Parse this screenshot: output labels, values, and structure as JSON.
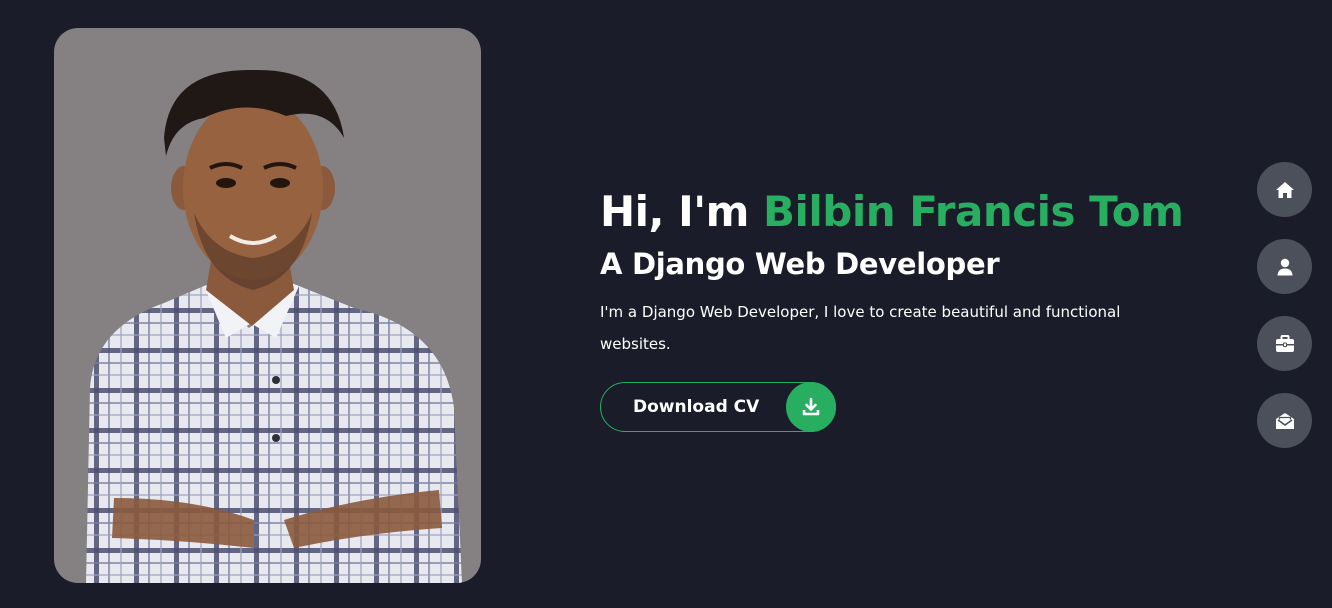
{
  "hero": {
    "greeting": "Hi, I'm ",
    "name": "Bilbin Francis Tom",
    "role": "A Django Web Developer",
    "description": "I'm a Django Web Developer, I love to create beautiful and functional websites.",
    "download_label": "Download CV"
  },
  "icons": {
    "download": "download-icon",
    "home": "home-icon",
    "about": "user-icon",
    "portfolio": "briefcase-icon",
    "contact": "envelope-open-icon"
  },
  "colors": {
    "accent": "#27ae60",
    "background": "#1a1c29",
    "nav_button": "#4b505a"
  }
}
